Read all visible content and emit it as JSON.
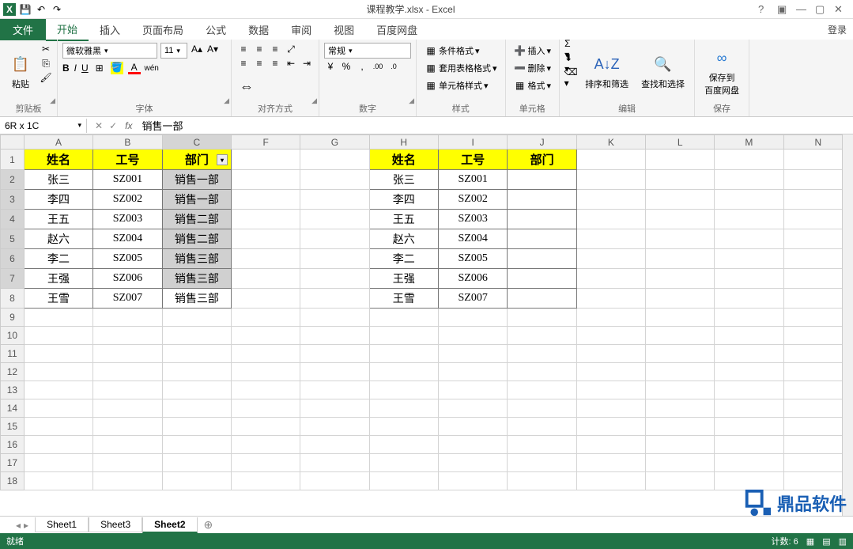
{
  "app": {
    "title": "课程教学.xlsx - Excel"
  },
  "qat": {
    "save": "💾",
    "undo": "↶",
    "redo": "↷"
  },
  "wincontrols": {
    "help": "?",
    "ribbon": "▣",
    "min": "—",
    "max": "▢",
    "close": "✕"
  },
  "tabs": {
    "file": "文件",
    "home": "开始",
    "insert": "插入",
    "pagelayout": "页面布局",
    "formulas": "公式",
    "data": "数据",
    "review": "审阅",
    "view": "视图",
    "baidu": "百度网盘",
    "login": "登录"
  },
  "ribbon": {
    "clipboard": {
      "label": "剪贴板",
      "paste": "粘贴"
    },
    "font": {
      "label": "字体",
      "family": "微软雅黑",
      "size": "11",
      "bold": "B",
      "italic": "I",
      "underline": "U"
    },
    "alignment": {
      "label": "对齐方式"
    },
    "number": {
      "label": "数字",
      "format": "常规"
    },
    "styles": {
      "label": "样式",
      "cond": "条件格式",
      "fmttable": "套用表格格式",
      "cellstyle": "单元格样式"
    },
    "cells": {
      "label": "单元格",
      "insert": "插入",
      "delete": "删除",
      "format": "格式"
    },
    "editing": {
      "label": "编辑",
      "sort": "排序和筛选",
      "find": "查找和选择"
    },
    "save": {
      "label": "保存",
      "savebaidu": "保存到\n百度网盘"
    }
  },
  "formulabar": {
    "namebox": "6R x 1C",
    "value": "销售一部"
  },
  "columns": [
    "A",
    "B",
    "C",
    "F",
    "G",
    "H",
    "I",
    "J",
    "K",
    "L",
    "M",
    "N"
  ],
  "rows": [
    "1",
    "2",
    "3",
    "4",
    "5",
    "6",
    "7",
    "8",
    "9",
    "10",
    "11",
    "12",
    "13",
    "14",
    "15",
    "16",
    "17",
    "18"
  ],
  "leftTable": {
    "headers": [
      "姓名",
      "工号",
      "部门"
    ],
    "data": [
      [
        "张三",
        "SZ001",
        "销售一部"
      ],
      [
        "李四",
        "SZ002",
        "销售一部"
      ],
      [
        "王五",
        "SZ003",
        "销售二部"
      ],
      [
        "赵六",
        "SZ004",
        "销售二部"
      ],
      [
        "李二",
        "SZ005",
        "销售三部"
      ],
      [
        "王强",
        "SZ006",
        "销售三部"
      ],
      [
        "王雪",
        "SZ007",
        "销售三部"
      ]
    ]
  },
  "rightTable": {
    "headers": [
      "姓名",
      "工号",
      "部门"
    ],
    "data": [
      [
        "张三",
        "SZ001",
        ""
      ],
      [
        "李四",
        "SZ002",
        ""
      ],
      [
        "王五",
        "SZ003",
        ""
      ],
      [
        "赵六",
        "SZ004",
        ""
      ],
      [
        "李二",
        "SZ005",
        ""
      ],
      [
        "王强",
        "SZ006",
        ""
      ],
      [
        "王雪",
        "SZ007",
        ""
      ]
    ]
  },
  "sheets": {
    "s1": "Sheet1",
    "s3": "Sheet3",
    "s2": "Sheet2"
  },
  "statusbar": {
    "ready": "就绪",
    "count": "计数: 6"
  },
  "watermark": {
    "text": "鼎品软件"
  }
}
